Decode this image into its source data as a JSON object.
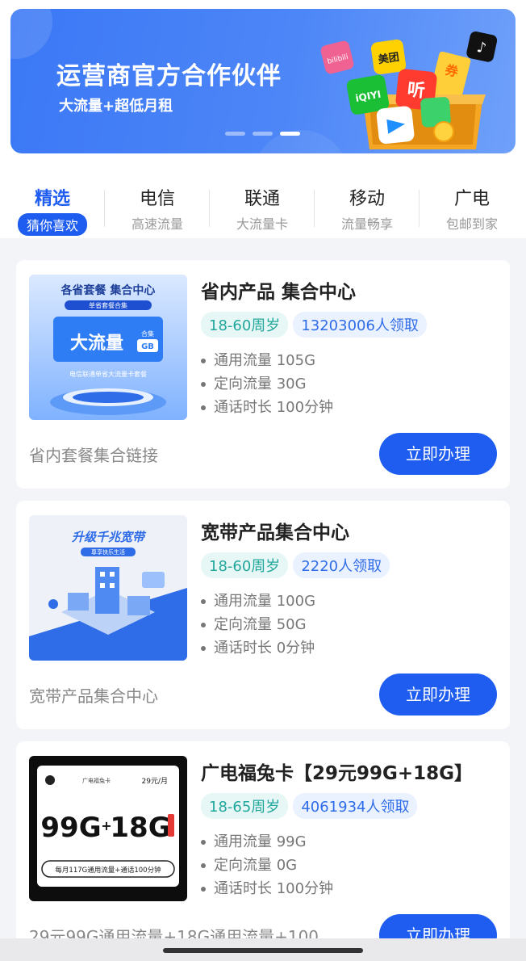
{
  "banner": {
    "title": "运营商官方合作伙伴",
    "subtitle": "大流量+超低月租",
    "app_labels": [
      "bilibili",
      "美团",
      "iQIYI",
      "听",
      "券"
    ],
    "page_indicator": {
      "count": 3,
      "active": 3
    }
  },
  "tabs": [
    {
      "label": "精选",
      "sub": "猜你喜欢",
      "active": true
    },
    {
      "label": "电信",
      "sub": "高速流量",
      "active": false
    },
    {
      "label": "联通",
      "sub": "大流量卡",
      "active": false
    },
    {
      "label": "移动",
      "sub": "流量畅享",
      "active": false
    },
    {
      "label": "广电",
      "sub": "包邮到家",
      "active": false
    }
  ],
  "products": [
    {
      "title": "省内产品 集合中心",
      "age": "18-60周岁",
      "claimed": "13203006人领取",
      "features": [
        "通用流量 105G",
        "定向流量 30G",
        "通话时长 100分钟"
      ],
      "description": "省内套餐集合链接",
      "button": "立即办理",
      "image_text": {
        "headline": "各省套餐 集合中心",
        "ribbon": "单省套餐合集",
        "big": "大流量",
        "badge1": "合集",
        "badge2": "GB",
        "footer": "电信联通单省大流量卡套餐"
      }
    },
    {
      "title": "宽带产品集合中心",
      "age": "18-60周岁",
      "claimed": "2220人领取",
      "features": [
        "通用流量 100G",
        "定向流量 50G",
        "通话时长 0分钟"
      ],
      "description": "宽带产品集合中心",
      "button": "立即办理",
      "image_text": {
        "headline": "升级千兆宽带",
        "ribbon": "尊享快乐生活"
      }
    },
    {
      "title": "广电福兔卡【29元99G+18G】",
      "age": "18-65周岁",
      "claimed": "4061934人领取",
      "features": [
        "通用流量 99G",
        "定向流量 0G",
        "通话时长 100分钟"
      ],
      "description": "29元99G通用流量+18G通用流量+100",
      "button": "立即办理",
      "image_text": {
        "brand": "广电福兔卡",
        "price": "29元/月",
        "big1": "99G",
        "plus": "+",
        "big2": "18G",
        "footer": "每月117G通用流量+通话100分钟"
      }
    }
  ],
  "colors": {
    "accent": "#1f5df0",
    "age_tag": "#22a79c",
    "claim_tag": "#2f6ce8",
    "banner": "#3b78f5"
  }
}
